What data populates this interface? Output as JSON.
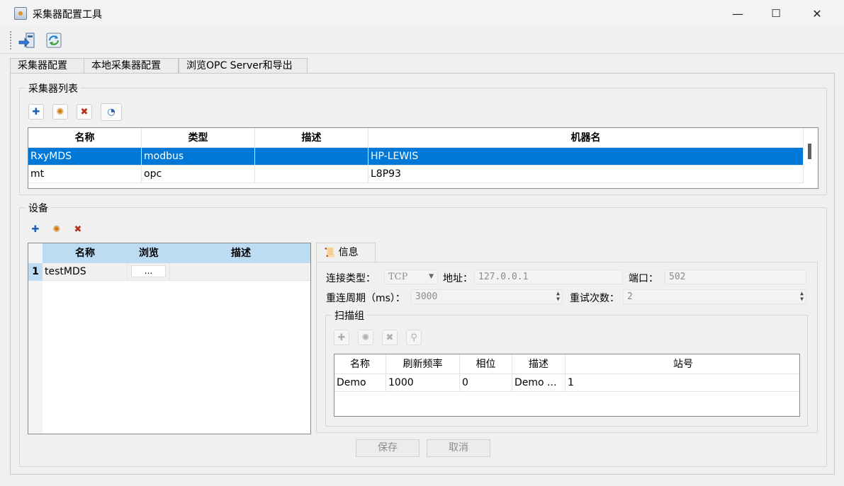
{
  "window": {
    "title": "采集器配置工具",
    "minimize": "—",
    "maximize": "☐",
    "close": "✕"
  },
  "tabs": [
    "采集器配置",
    "本地采集器配置",
    "浏览OPC Server和导出"
  ],
  "collectors": {
    "title": "采集器列表",
    "columns": [
      "名称",
      "类型",
      "描述",
      "机器名"
    ],
    "rows": [
      {
        "name": "RxyMDS",
        "type": "modbus",
        "desc": "",
        "machine": "HP-LEWIS"
      },
      {
        "name": "mt",
        "type": "opc",
        "desc": "",
        "machine": "L8P93"
      }
    ]
  },
  "devices": {
    "title": "设备",
    "columns": [
      "名称",
      "浏览",
      "描述"
    ],
    "rows": [
      {
        "index": "1",
        "name": "testMDS",
        "browse": "...",
        "desc": ""
      }
    ]
  },
  "info": {
    "tab": "信息",
    "conn_type_label": "连接类型：",
    "conn_type_value": "TCP",
    "address_label": "地址：",
    "address_value": "127.0.0.1",
    "port_label": "端口：",
    "port_value": "502",
    "reconnect_label": "重连周期（ms）：",
    "reconnect_value": "3000",
    "retry_label": "重试次数：",
    "retry_value": "2"
  },
  "scan_group": {
    "title": "扫描组",
    "columns": [
      "名称",
      "刷新频率",
      "相位",
      "描述",
      "站号"
    ],
    "rows": [
      {
        "name": "Demo",
        "rate": "1000",
        "phase": "0",
        "desc": "Demo ...",
        "station": "1"
      }
    ]
  },
  "buttons": {
    "save": "保存",
    "cancel": "取消"
  },
  "colors": {
    "selection": "#0078d7",
    "header_selected": "#bcdcf4"
  }
}
